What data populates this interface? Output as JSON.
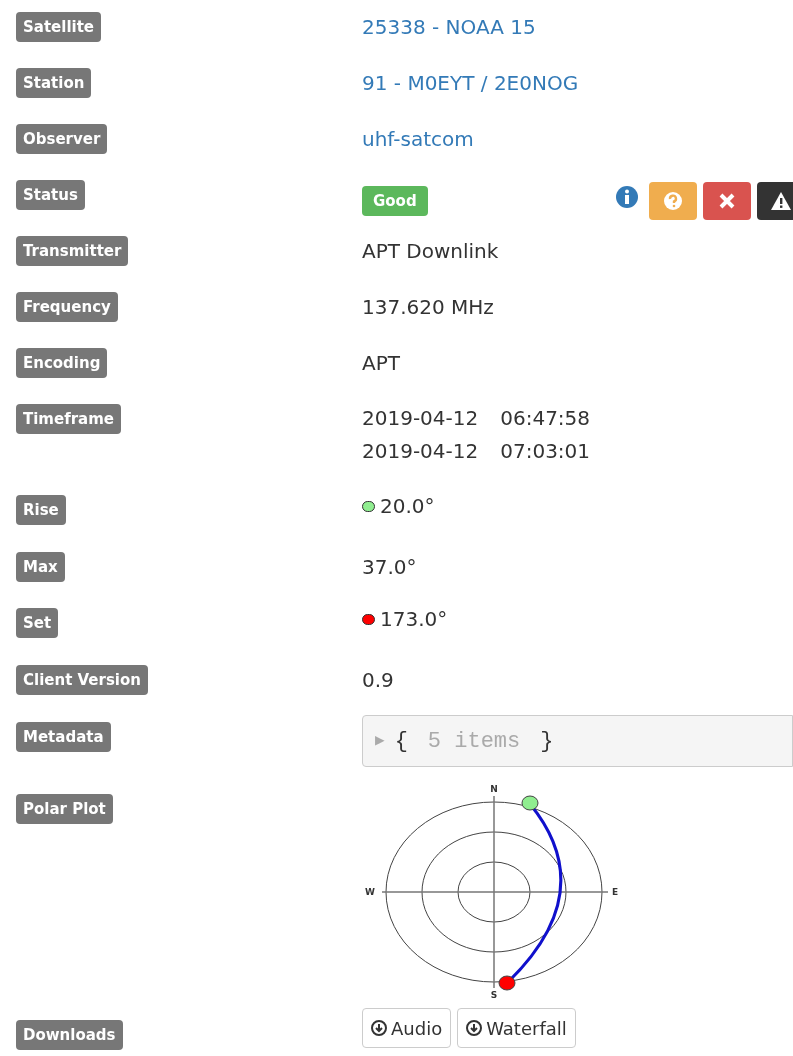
{
  "rows": [
    {
      "label": "Satellite",
      "kind": "link",
      "text": "25338 - NOAA 15"
    },
    {
      "label": "Station",
      "kind": "link",
      "text": "91 - M0EYT / 2E0NOG"
    },
    {
      "label": "Observer",
      "kind": "link",
      "text": "uhf-satcom"
    },
    {
      "label": "Status",
      "kind": "status",
      "text": "Good"
    },
    {
      "label": "Transmitter",
      "kind": "text",
      "text": "APT Downlink"
    },
    {
      "label": "Frequency",
      "kind": "text",
      "text": "137.620 MHz"
    },
    {
      "label": "Encoding",
      "kind": "text",
      "text": "APT"
    },
    {
      "label": "Timeframe",
      "kind": "timeframe",
      "lines": [
        {
          "date": "2019-04-12",
          "time": "06:47:58"
        },
        {
          "date": "2019-04-12",
          "time": "07:03:01"
        }
      ]
    },
    {
      "label": "Rise",
      "kind": "position",
      "text": "20.0°",
      "color": "#90ee90"
    },
    {
      "label": "Max",
      "kind": "text",
      "text": "37.0°"
    },
    {
      "label": "Set",
      "kind": "position",
      "text": "173.0°",
      "color": "#ff0000"
    },
    {
      "label": "Client Version",
      "kind": "text",
      "text": "0.9"
    },
    {
      "label": "Metadata",
      "kind": "metadata",
      "toggle": "▶",
      "open": "{",
      "summary": "5 items",
      "close": "}"
    },
    {
      "label": "Polar Plot",
      "kind": "polar",
      "north": "N",
      "east": "E",
      "south": "S",
      "west": "W"
    },
    {
      "label": "Downloads",
      "kind": "downloads",
      "buttons": [
        "Audio",
        "Waterfall"
      ]
    }
  ]
}
